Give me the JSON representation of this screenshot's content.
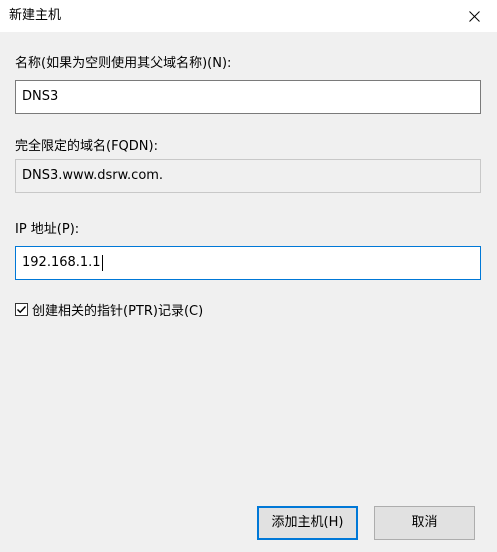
{
  "dialog": {
    "title": "新建主机",
    "close_icon": "close-icon"
  },
  "form": {
    "name": {
      "label": "名称(如果为空则使用其父域名称)(N):",
      "value": "DNS3"
    },
    "fqdn": {
      "label": "完全限定的域名(FQDN):",
      "value": "DNS3.www.dsrw.com."
    },
    "ip": {
      "label": "IP 地址(P):",
      "value": "192.168.1.1"
    },
    "ptr": {
      "label": "创建相关的指针(PTR)记录(C)",
      "checked": true
    }
  },
  "buttons": {
    "add_host": "添加主机(H)",
    "cancel": "取消"
  },
  "colors": {
    "accent": "#0078d7",
    "dialog_bg": "#f0f0f0"
  }
}
